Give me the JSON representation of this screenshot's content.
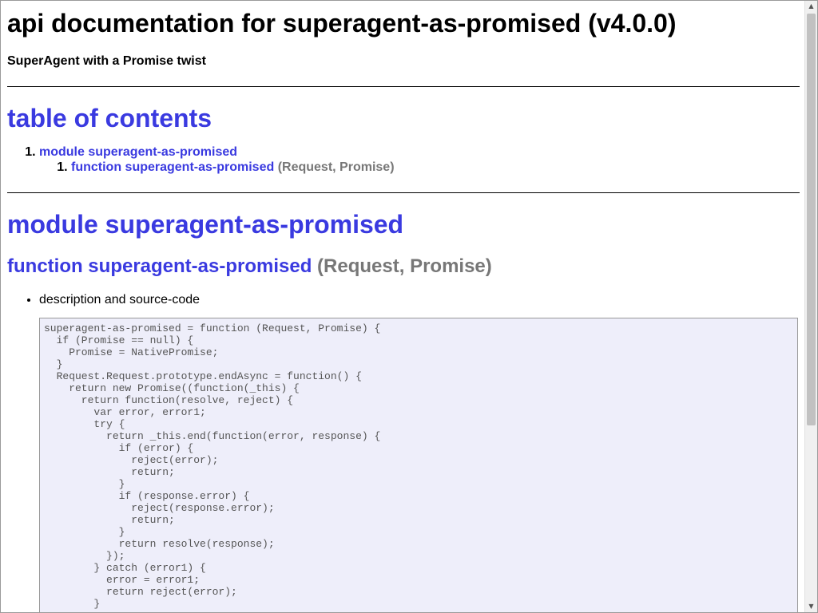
{
  "page": {
    "title": "api documentation for superagent-as-promised (v4.0.0)",
    "subtitle": "SuperAgent with a Promise twist"
  },
  "toc": {
    "heading": "table of contents",
    "module_link": "module superagent-as-promised",
    "function_link": "function superagent-as-promised",
    "function_sig": "(Request, Promise)"
  },
  "module": {
    "heading": "module superagent-as-promised"
  },
  "function": {
    "name": "function superagent-as-promised",
    "signature": "(Request, Promise)",
    "description_label": "description and source-code",
    "source": "superagent-as-promised = function (Request, Promise) {\n  if (Promise == null) {\n    Promise = NativePromise;\n  }\n  Request.Request.prototype.endAsync = function() {\n    return new Promise((function(_this) {\n      return function(resolve, reject) {\n        var error, error1;\n        try {\n          return _this.end(function(error, response) {\n            if (error) {\n              reject(error);\n              return;\n            }\n            if (response.error) {\n              reject(response.error);\n              return;\n            }\n            return resolve(response);\n          });\n        } catch (error1) {\n          error = error1;\n          return reject(error);\n        }"
  }
}
